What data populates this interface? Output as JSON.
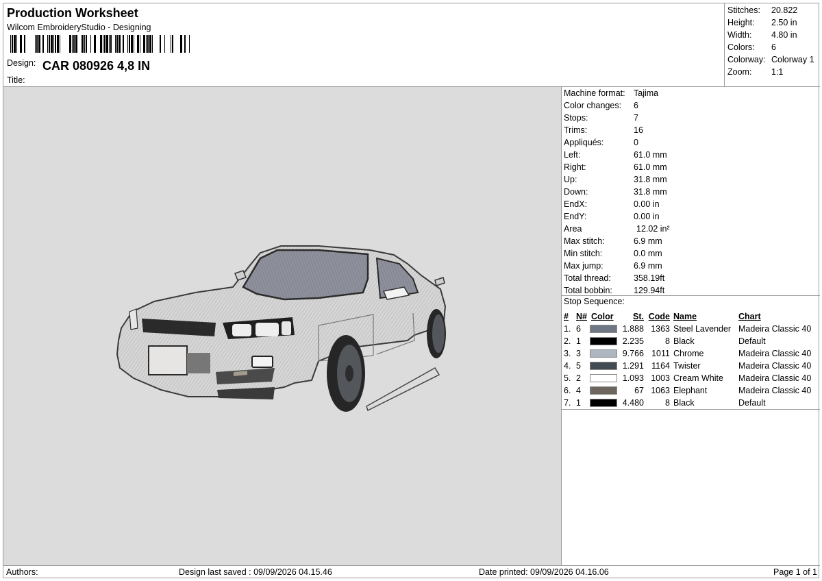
{
  "header": {
    "title": "Production Worksheet",
    "software": "Wilcom EmbroideryStudio - Designing",
    "design_label": "Design:",
    "design_name": "CAR 080926 4,8 IN",
    "title_label": "Title:"
  },
  "summary": [
    {
      "label": "Stitches:",
      "value": "20.822"
    },
    {
      "label": "Height:",
      "value": "2.50 in"
    },
    {
      "label": "Width:",
      "value": "4.80 in"
    },
    {
      "label": "Colors:",
      "value": "6"
    },
    {
      "label": "Colorway:",
      "value": "Colorway 1"
    },
    {
      "label": "Zoom:",
      "value": "1:1"
    }
  ],
  "details": [
    {
      "label": "Machine format:",
      "value": "Tajima"
    },
    {
      "label": "Color changes:",
      "value": "6"
    },
    {
      "label": "Stops:",
      "value": "7"
    },
    {
      "label": "Trims:",
      "value": "16"
    },
    {
      "label": "Appliqués:",
      "value": "0"
    },
    {
      "label": "Left:",
      "value": "61.0 mm"
    },
    {
      "label": "Right:",
      "value": "61.0 mm"
    },
    {
      "label": "Up:",
      "value": "31.8 mm"
    },
    {
      "label": "Down:",
      "value": "31.8 mm"
    },
    {
      "label": "EndX:",
      "value": "0.00 in"
    },
    {
      "label": "EndY:",
      "value": "0.00 in"
    },
    {
      "label": "Area",
      "value": "12.02 in²"
    },
    {
      "label": "Max stitch:",
      "value": "6.9 mm"
    },
    {
      "label": "Min stitch:",
      "value": "0.0 mm"
    },
    {
      "label": "Max jump:",
      "value": "6.9 mm"
    },
    {
      "label": "Total thread:",
      "value": "358.19ft"
    },
    {
      "label": "Total bobbin:",
      "value": "129.94ft"
    }
  ],
  "stop_sequence": {
    "title": "Stop Sequence:",
    "headers": {
      "num": "#",
      "n": "N#",
      "color": "Color",
      "st": "St.",
      "code": "Code",
      "name": "Name",
      "chart": "Chart"
    },
    "rows": [
      {
        "num": "1.",
        "n": "6",
        "swatch": "#6f7784",
        "st": "1.888",
        "code": "1363",
        "name": "Steel Lavender",
        "chart": "Madeira Classic 40"
      },
      {
        "num": "2.",
        "n": "1",
        "swatch": "#000000",
        "st": "2.235",
        "code": "8",
        "name": "Black",
        "chart": "Default"
      },
      {
        "num": "3.",
        "n": "3",
        "swatch": "#aeb6bf",
        "st": "9.766",
        "code": "1011",
        "name": "Chrome",
        "chart": "Madeira Classic 40"
      },
      {
        "num": "4.",
        "n": "5",
        "swatch": "#424b52",
        "st": "1.291",
        "code": "1164",
        "name": "Twister",
        "chart": "Madeira Classic 40"
      },
      {
        "num": "5.",
        "n": "2",
        "swatch": "#ffffff",
        "st": "1.093",
        "code": "1003",
        "name": "Cream White",
        "chart": "Madeira Classic 40"
      },
      {
        "num": "6.",
        "n": "4",
        "swatch": "#6d665e",
        "st": "67",
        "code": "1063",
        "name": "Elephant",
        "chart": "Madeira Classic 40"
      },
      {
        "num": "7.",
        "n": "1",
        "swatch": "#000000",
        "st": "4.480",
        "code": "8",
        "name": "Black",
        "chart": "Default"
      }
    ]
  },
  "footer": {
    "authors": "Authors:",
    "saved": "Design last saved : 09/09/2026 04.15.46",
    "printed": "Date printed: 09/09/2026 04.16.06",
    "page": "Page 1 of 1"
  },
  "colors": {
    "preview_bg": "#dcdcdc",
    "car_body": "#d4d4d4",
    "car_glass": "#8a8d9a",
    "outline": "#2b2b2b"
  }
}
